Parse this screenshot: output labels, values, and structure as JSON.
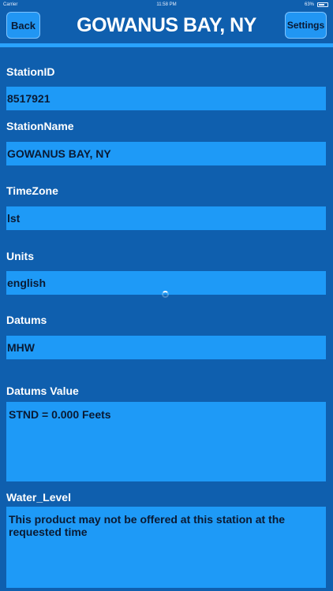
{
  "status_bar": {
    "carrier": "Carrier",
    "time": "11:58 PM",
    "battery": "63%"
  },
  "nav": {
    "back_label": "Back",
    "title": "GOWANUS BAY, NY",
    "settings_label": "Settings"
  },
  "fields": {
    "station_id": {
      "label": "StationID",
      "value": "8517921"
    },
    "station_name": {
      "label": "StationName",
      "value": "GOWANUS BAY, NY"
    },
    "time_zone": {
      "label": "TimeZone",
      "value": "lst"
    },
    "units": {
      "label": "Units",
      "value": "english"
    },
    "datums": {
      "label": "Datums",
      "value": "MHW"
    },
    "datums_value": {
      "label": "Datums Value",
      "value": "STND  = 0.000 Feets"
    },
    "water_level": {
      "label": "Water_Level",
      "value": "This product may not be offered at this station at the requested time"
    }
  }
}
